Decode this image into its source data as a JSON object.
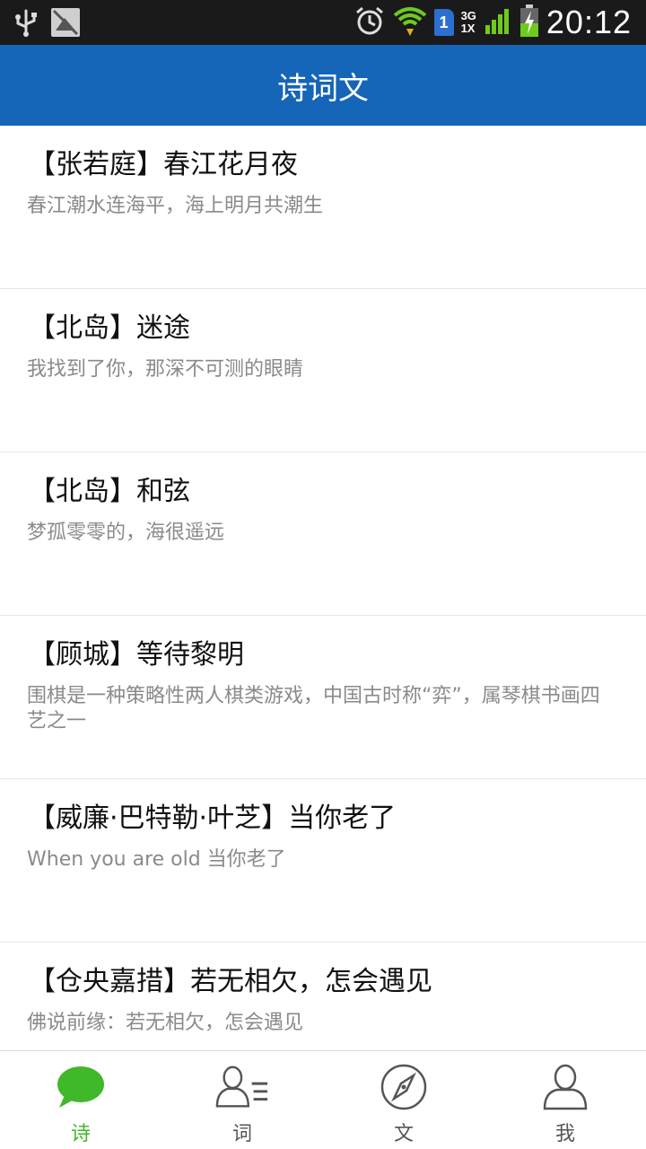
{
  "status_bar": {
    "time": "20:12",
    "network_top": "3G",
    "network_bottom": "1X",
    "sim_slot": "1"
  },
  "app_bar": {
    "title": "诗词文"
  },
  "list": [
    {
      "title": "【张若庭】春江花月夜",
      "desc": "春江潮水连海平，海上明月共潮生"
    },
    {
      "title": "【北岛】迷途",
      "desc": "我找到了你，那深不可测的眼睛"
    },
    {
      "title": "【北岛】和弦",
      "desc": "梦孤零零的，海很遥远"
    },
    {
      "title": "【顾城】等待黎明",
      "desc": "围棋是一种策略性两人棋类游戏，中国古时称“弈”，属琴棋书画四艺之一"
    },
    {
      "title": "【威廉·巴特勒·叶芝】当你老了",
      "desc": "When you are old 当你老了"
    },
    {
      "title": "【仓央嘉措】若无相欠，怎会遇见",
      "desc": "佛说前缘：若无相欠，怎会遇见"
    }
  ],
  "bottom_nav": [
    {
      "label": "诗",
      "icon": "chat-bubble-icon",
      "active": true
    },
    {
      "label": "词",
      "icon": "contacts-list-icon",
      "active": false
    },
    {
      "label": "文",
      "icon": "compass-icon",
      "active": false
    },
    {
      "label": "我",
      "icon": "person-icon",
      "active": false
    }
  ],
  "colors": {
    "app_bar": "#1565b8",
    "active_tab": "#3fb82a",
    "status_bar": "#1a1a1a"
  }
}
